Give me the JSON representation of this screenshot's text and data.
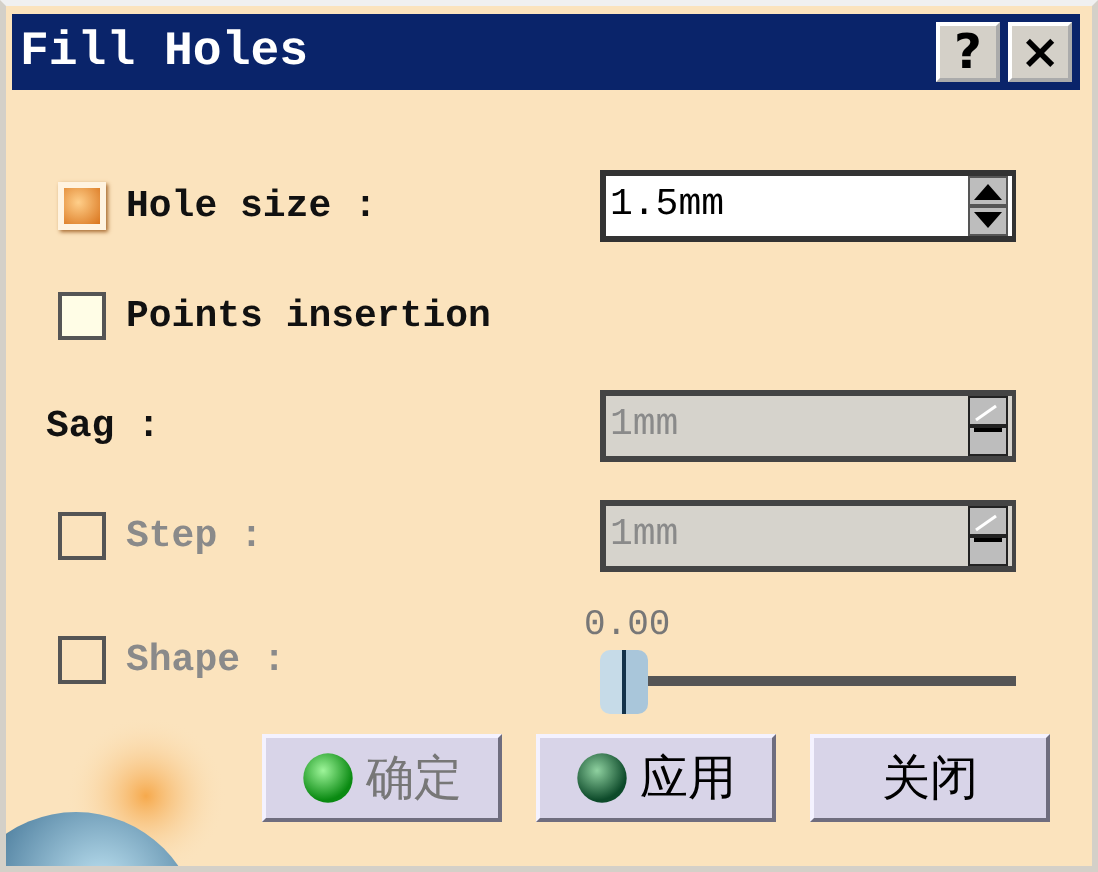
{
  "window": {
    "title": "Fill Holes",
    "title_buttons": [
      {
        "label": "?"
      },
      {
        "label": "×"
      }
    ]
  },
  "rows": [
    {
      "kind": "checkbox_spinner",
      "label": "Hole size :",
      "checked": true,
      "disabled": false,
      "value": "1.5mm"
    },
    {
      "kind": "checkbox",
      "label": "Points insertion",
      "checked": false,
      "disabled": false
    },
    {
      "kind": "label_spinner",
      "label": "Sag :",
      "disabled": true,
      "value": "1mm"
    },
    {
      "kind": "checkbox_spinner",
      "label": "Step :",
      "checked": false,
      "disabled": true,
      "value": "1mm"
    },
    {
      "kind": "checkbox_slider",
      "label": "Shape :",
      "checked": false,
      "disabled": true,
      "reading": "0.00",
      "level": 0
    }
  ],
  "buttons": [
    {
      "label": "确定",
      "disabled": true
    },
    {
      "label": "应用",
      "disabled": false
    },
    {
      "label": "关闭",
      "disabled": false
    }
  ]
}
